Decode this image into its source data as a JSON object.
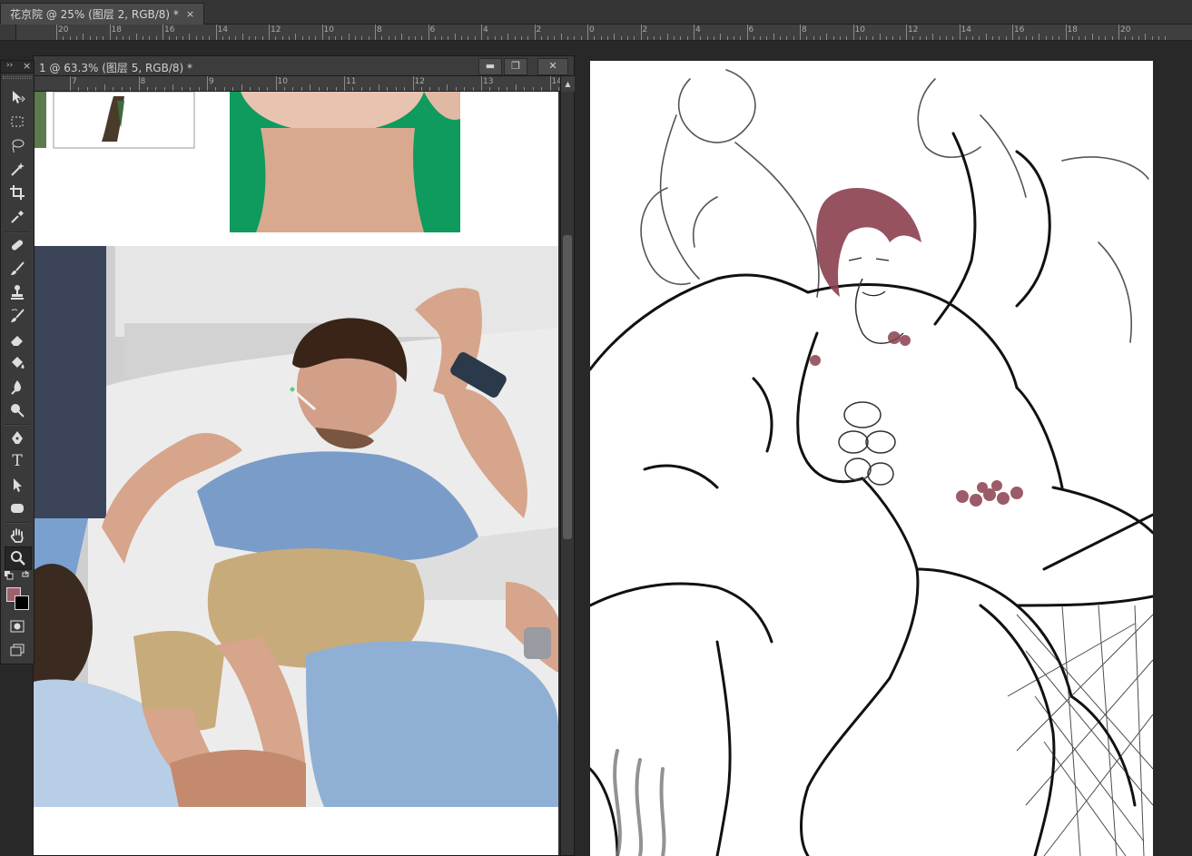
{
  "main_document": {
    "tab_title": "花京院 @ 25% (图层 2, RGB/8) *",
    "close_glyph": "×",
    "ruler_labels": [
      "20",
      "18",
      "16",
      "14",
      "12",
      "10",
      "8",
      "6",
      "4",
      "2",
      "0",
      "2",
      "4",
      "6",
      "8",
      "10",
      "12",
      "14",
      "16",
      "18",
      "20"
    ]
  },
  "floating_document": {
    "title": "1 @ 63.3% (图层 5, RGB/8) *",
    "minimize_glyph": "▬",
    "restore_glyph": "❐",
    "close_glyph": "✕",
    "ruler_labels": [
      "7",
      "8",
      "9",
      "10",
      "11",
      "12",
      "13",
      "14"
    ]
  },
  "tools": {
    "items": [
      {
        "name": "move-tool",
        "icon": "move-icon"
      },
      {
        "name": "marquee-tool",
        "icon": "rect-marquee-icon"
      },
      {
        "name": "lasso-tool",
        "icon": "lasso-icon"
      },
      {
        "name": "magic-wand-tool",
        "icon": "magic-wand-icon"
      },
      {
        "name": "crop-tool",
        "icon": "crop-icon"
      },
      {
        "name": "eyedropper-tool",
        "icon": "eyedropper-icon"
      },
      {
        "name": "healing-brush-tool",
        "icon": "bandage-icon"
      },
      {
        "name": "brush-tool",
        "icon": "brush-icon"
      },
      {
        "name": "clone-stamp-tool",
        "icon": "stamp-icon"
      },
      {
        "name": "history-brush-tool",
        "icon": "history-brush-icon"
      },
      {
        "name": "eraser-tool",
        "icon": "eraser-icon"
      },
      {
        "name": "paint-bucket-tool",
        "icon": "bucket-icon"
      },
      {
        "name": "blur-tool",
        "icon": "blur-icon"
      },
      {
        "name": "dodge-tool",
        "icon": "dodge-icon"
      },
      {
        "name": "pen-tool",
        "icon": "pen-icon"
      },
      {
        "name": "type-tool",
        "icon": "type-icon"
      },
      {
        "name": "path-selection-tool",
        "icon": "arrow-icon"
      },
      {
        "name": "shape-tool",
        "icon": "rounded-rect-icon"
      },
      {
        "name": "hand-tool",
        "icon": "hand-icon"
      },
      {
        "name": "zoom-tool",
        "icon": "zoom-icon",
        "active": true
      }
    ],
    "type_glyph": "T",
    "foreground_color": "#a0606b",
    "background_color": "#000000"
  },
  "colors": {
    "ui_dark": "#282828",
    "panel": "#3a3a3a",
    "green_screen": "#0f9a5e",
    "hair_maroon": "#8b3f4e",
    "shirt_blue": "#7a9cc8"
  }
}
